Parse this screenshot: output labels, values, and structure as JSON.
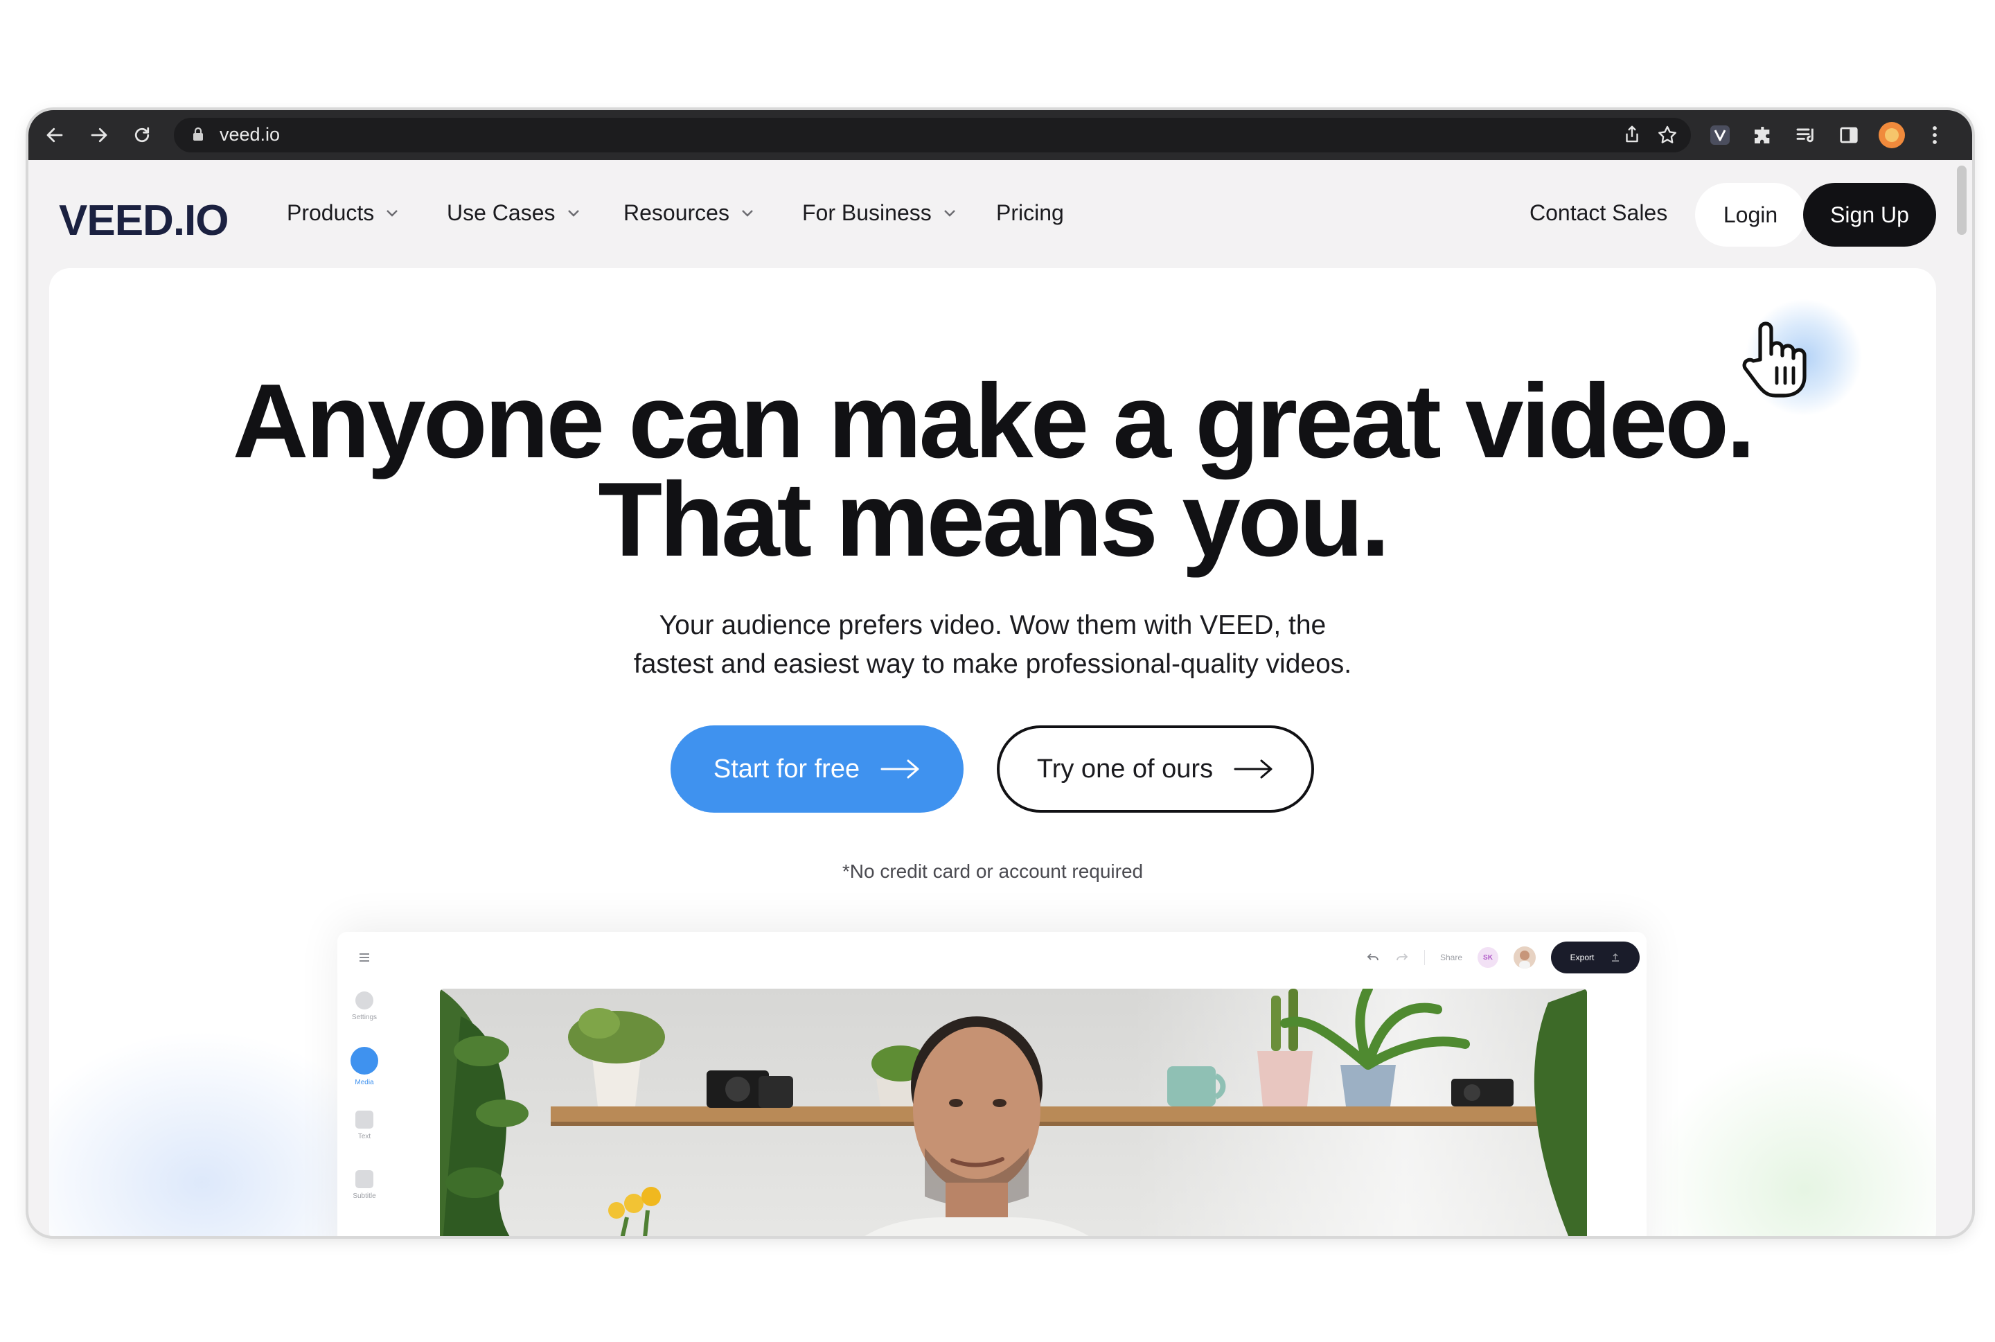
{
  "browser": {
    "url": "veed.io",
    "profile_color": "#f08a3c"
  },
  "header": {
    "logo": "VEED.IO",
    "nav": [
      {
        "label": "Products",
        "has_dropdown": true
      },
      {
        "label": "Use Cases",
        "has_dropdown": true
      },
      {
        "label": "Resources",
        "has_dropdown": true
      },
      {
        "label": "For Business",
        "has_dropdown": true
      },
      {
        "label": "Pricing",
        "has_dropdown": false
      }
    ],
    "contact_sales": "Contact Sales",
    "login": "Login",
    "signup": "Sign Up"
  },
  "hero": {
    "headline_line1": "Anyone can make a great video.",
    "headline_line2": "That means you.",
    "subhead_line1": "Your audience prefers video. Wow them with VEED, the",
    "subhead_line2": "fastest and easiest way to make professional-quality videos.",
    "cta_primary": "Start for free",
    "cta_secondary": "Try one of ours",
    "note": "*No credit card or account required"
  },
  "editor": {
    "sidebar": [
      {
        "label": "Settings",
        "active": false
      },
      {
        "label": "Media",
        "active": true
      },
      {
        "label": "Text",
        "active": false
      },
      {
        "label": "Subtitle",
        "active": false
      }
    ],
    "share": "Share",
    "avatar_initials": "SK",
    "export": "Export"
  },
  "colors": {
    "brand_blue": "#3f92ef",
    "dark": "#111114",
    "logo": "#1b2140"
  }
}
